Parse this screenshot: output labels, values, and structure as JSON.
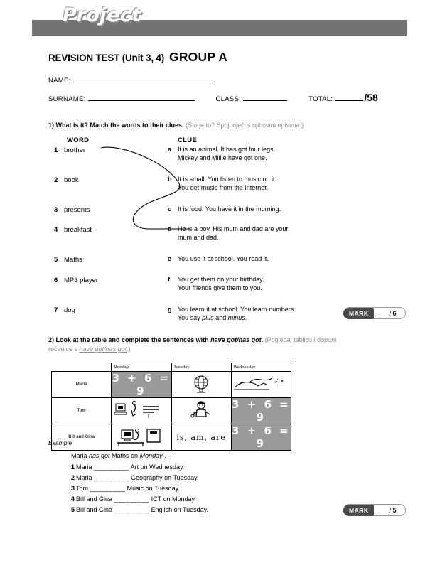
{
  "brand": {
    "logo_text": "Project"
  },
  "header": {
    "title_main": "REVISION TEST (Unit 3, 4)",
    "title_group": "GROUP A",
    "name_label": "NAME:",
    "surname_label": "SURNAME:",
    "class_label": "CLASS:",
    "total_label": "TOTAL:",
    "total_score": "/58"
  },
  "exercise1": {
    "number": "1)",
    "instruction_en": "What is it? Match the words to their clues.",
    "instruction_hr": "(Što je to? Spoji riječi s njihovim opisima.)",
    "col_head_word": "WORD",
    "col_head_clue": "CLUE",
    "words": [
      {
        "num": "1",
        "text": "brother"
      },
      {
        "num": "2",
        "text": "book"
      },
      {
        "num": "3",
        "text": "presents"
      },
      {
        "num": "4",
        "text": "breakfast"
      },
      {
        "num": "5",
        "text": "Maths"
      },
      {
        "num": "6",
        "text": "MP3 player"
      },
      {
        "num": "7",
        "text": "dog"
      }
    ],
    "clues": [
      {
        "letter": "a",
        "line1": "It is an animal. It has got four legs.",
        "line2": "Mickey and Millie have got one."
      },
      {
        "letter": "b",
        "line1": "It is small. You listen to music on it.",
        "line2": "You get music from the Internet."
      },
      {
        "letter": "c",
        "line1": "It is food. You have it in the morning.",
        "line2": ""
      },
      {
        "letter": "d",
        "line1": "He is a boy. His mum and dad are your",
        "line2": "mum and dad."
      },
      {
        "letter": "e",
        "line1": "You use it at school. You read it.",
        "line2": ""
      },
      {
        "letter": "f",
        "line1": "You get them on your birthday.",
        "line2": "Your friends give them to you."
      },
      {
        "letter": "g",
        "line1": "You learn it at school. You learn numbers.",
        "line2": "You say plus and minus."
      }
    ],
    "mark": {
      "label": "MARK",
      "out_of": "/ 6"
    }
  },
  "exercise2": {
    "number": "2)",
    "instruction_en_pre": "Look at the table and complete the sentences with ",
    "instruction_en_bold": "have got/has got",
    "instruction_en_post": ".",
    "instruction_hr_pre": "(Pogledaj tablicu i dopuni",
    "instruction_hr_line2_pre": "rečenice s ",
    "instruction_hr_bold": "have got/has got",
    "instruction_hr_post": ".)",
    "table": {
      "columns": [
        "Monday",
        "Tuesday",
        "Wednesday"
      ],
      "rows": [
        {
          "label": "Maria",
          "cells": [
            "maths",
            "geography",
            "art"
          ]
        },
        {
          "label": "Tom",
          "cells": [
            "ict",
            "music",
            "maths"
          ]
        },
        {
          "label": "Bill and Gina",
          "cells": [
            "ict",
            "english",
            "maths"
          ]
        }
      ],
      "maths_text": "3 + 6 = 9",
      "english_text": "is, am, are"
    },
    "example_label": "Example",
    "example_sentence": {
      "pre": "Maria ",
      "answer1": "has got",
      "mid": " Maths on ",
      "answer2": "Monday",
      "post": " ."
    },
    "sentences": [
      {
        "num": "1",
        "pre": "Maria ",
        "blank": "_________",
        "post": " Art on Wednesday."
      },
      {
        "num": "2",
        "pre": "Maria ",
        "blank": "_________",
        "post": " Geography on Tuesday."
      },
      {
        "num": "3",
        "pre": "Tom ",
        "blank": "_________",
        "post": " Music on Tuesday."
      },
      {
        "num": "4",
        "pre": "Bill and Gina ",
        "blank": "_________",
        "post": " ICT on Monday."
      },
      {
        "num": "5",
        "pre": "Bill and Gina ",
        "blank": "_________",
        "post": " English on Tuesday."
      }
    ],
    "mark": {
      "label": "MARK",
      "out_of": "/ 5"
    }
  }
}
